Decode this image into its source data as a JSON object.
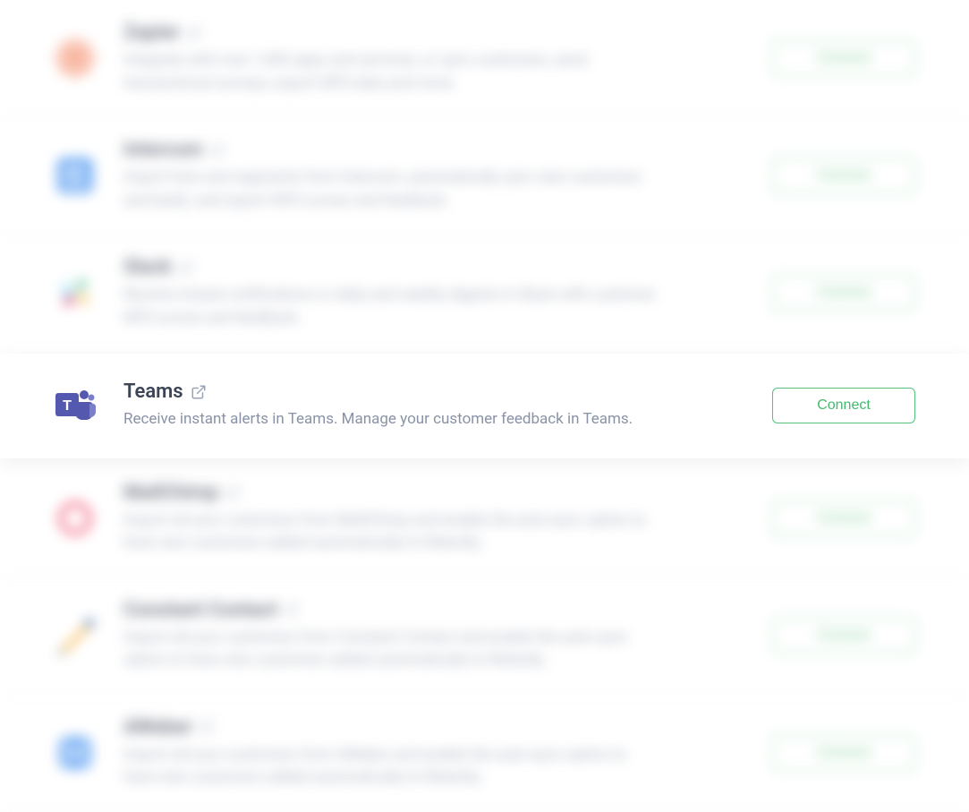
{
  "integrations": [
    {
      "name": "Zapier",
      "desc": "Integrate with over 1,500 apps and services, or sync customers, send transactional surveys, export NPS data and more.",
      "button": "Connect",
      "iconColor": "#f05a28",
      "focused": false
    },
    {
      "name": "Intercom",
      "desc": "Import lists and segments from Intercom, automatically sync new customers and leads, and export NPS scores and feedback.",
      "button": "Connect",
      "iconColor": "#3f8ef0",
      "focused": false
    },
    {
      "name": "Slack",
      "desc": "Receive instant notifications or daily and weekly digests in Slack with customer NPS scores and feedback.",
      "button": "Connect",
      "iconColor": "#e01e5a",
      "focused": false
    },
    {
      "name": "Teams",
      "desc": "Receive instant alerts in Teams. Manage your customer feedback in Teams.",
      "button": "Connect",
      "iconColor": "#5558af",
      "focused": true
    },
    {
      "name": "MailChimp",
      "desc": "Import all your customers from MailChimp and enable the auto-sync option to have new customers added automatically to Retently.",
      "button": "Connect",
      "iconColor": "#f04a6a",
      "focused": false
    },
    {
      "name": "Constant Contact",
      "desc": "Import all your customers from Constant Contact and enable the auto-sync option to have new customers added automatically to Retently.",
      "button": "Connect",
      "iconColor": "#f5a623",
      "focused": false
    },
    {
      "name": "AWeber",
      "desc": "Import all your customers from AWeber and enable the auto-sync option to have new customers added automatically to Retently.",
      "button": "Connect",
      "iconColor": "#3f8ef0",
      "focused": false
    }
  ]
}
